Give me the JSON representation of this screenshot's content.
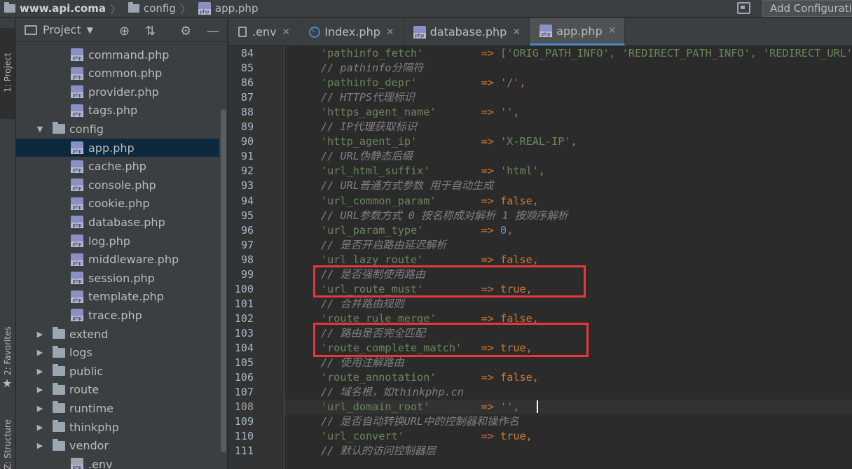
{
  "breadcrumb": {
    "root": "www.api.coma",
    "folder": "config",
    "file": "app.php"
  },
  "toolbar": {
    "add_config_label": "Add Configurati"
  },
  "left_strip": {
    "project": "1: Project",
    "favorites": "2: Favorites",
    "structure": "Z: Structure"
  },
  "project_panel": {
    "title": "Project",
    "tree": [
      {
        "label": "command.php",
        "type": "php",
        "indent": 2
      },
      {
        "label": "common.php",
        "type": "php",
        "indent": 2
      },
      {
        "label": "provider.php",
        "type": "php",
        "indent": 2
      },
      {
        "label": "tags.php",
        "type": "php",
        "indent": 2
      },
      {
        "label": "config",
        "type": "dir-open",
        "indent": 1
      },
      {
        "label": "app.php",
        "type": "php",
        "indent": 2,
        "selected": true
      },
      {
        "label": "cache.php",
        "type": "php",
        "indent": 2
      },
      {
        "label": "console.php",
        "type": "php",
        "indent": 2
      },
      {
        "label": "cookie.php",
        "type": "php",
        "indent": 2
      },
      {
        "label": "database.php",
        "type": "php",
        "indent": 2
      },
      {
        "label": "log.php",
        "type": "php",
        "indent": 2
      },
      {
        "label": "middleware.php",
        "type": "php",
        "indent": 2
      },
      {
        "label": "session.php",
        "type": "php",
        "indent": 2
      },
      {
        "label": "template.php",
        "type": "php",
        "indent": 2
      },
      {
        "label": "trace.php",
        "type": "php",
        "indent": 2
      },
      {
        "label": "extend",
        "type": "dir",
        "indent": 1
      },
      {
        "label": "logs",
        "type": "dir",
        "indent": 1
      },
      {
        "label": "public",
        "type": "dir",
        "indent": 1
      },
      {
        "label": "route",
        "type": "dir",
        "indent": 1
      },
      {
        "label": "runtime",
        "type": "dir",
        "indent": 1
      },
      {
        "label": "thinkphp",
        "type": "dir",
        "indent": 1
      },
      {
        "label": "vendor",
        "type": "dir",
        "indent": 1
      },
      {
        "label": ".env",
        "type": "file",
        "indent": 1
      }
    ]
  },
  "tabs": [
    {
      "label": ".env",
      "icon": "env-file-icon"
    },
    {
      "label": "Index.php",
      "icon": "class-icon"
    },
    {
      "label": "database.php",
      "icon": "php-file-icon"
    },
    {
      "label": "app.php",
      "icon": "php-file-icon",
      "active": true
    }
  ],
  "editor": {
    "current_line": "108",
    "lines": [
      {
        "n": "84",
        "kind": "entry",
        "key": "'pathinfo_fetch'",
        "pad": "         ",
        "val": "['ORIG_PATH_INFO', 'REDIRECT_PATH_INFO', 'REDIRECT_URL']",
        "vtype": "str"
      },
      {
        "n": "85",
        "kind": "cmt",
        "text": "// pathinfo分隔符"
      },
      {
        "n": "86",
        "kind": "entry",
        "key": "'pathinfo_depr'",
        "pad": "          ",
        "val": "'/'",
        "vtype": "str"
      },
      {
        "n": "87",
        "kind": "cmt",
        "text": "// HTTPS代理标识"
      },
      {
        "n": "88",
        "kind": "entry",
        "key": "'https_agent_name'",
        "pad": "       ",
        "val": "''",
        "vtype": "str"
      },
      {
        "n": "89",
        "kind": "cmt",
        "text": "// IP代理获取标识"
      },
      {
        "n": "90",
        "kind": "entry",
        "key": "'http_agent_ip'",
        "pad": "          ",
        "val": "'X-REAL-IP'",
        "vtype": "str"
      },
      {
        "n": "91",
        "kind": "cmt",
        "text": "// URL伪静态后缀"
      },
      {
        "n": "92",
        "kind": "entry",
        "key": "'url_html_suffix'",
        "pad": "        ",
        "val": "'html'",
        "vtype": "str"
      },
      {
        "n": "93",
        "kind": "cmt",
        "text": "// URL普通方式参数 用于自动生成"
      },
      {
        "n": "94",
        "kind": "entry",
        "key": "'url_common_param'",
        "pad": "       ",
        "val": "false",
        "vtype": "kw"
      },
      {
        "n": "95",
        "kind": "cmt",
        "text": "// URL参数方式 0 按名称成对解析 1 按顺序解析"
      },
      {
        "n": "96",
        "kind": "entry",
        "key": "'url_param_type'",
        "pad": "         ",
        "val": "0",
        "vtype": "num"
      },
      {
        "n": "97",
        "kind": "cmt",
        "text": "// 是否开启路由延迟解析"
      },
      {
        "n": "98",
        "kind": "entry",
        "key": "'url_lazy_route'",
        "pad": "         ",
        "val": "false",
        "vtype": "kw"
      },
      {
        "n": "99",
        "kind": "cmt",
        "text": "// 是否强制使用路由"
      },
      {
        "n": "100",
        "kind": "entry",
        "key": "'url_route_must'",
        "pad": "         ",
        "val": "true",
        "vtype": "kw"
      },
      {
        "n": "101",
        "kind": "cmt",
        "text": "// 合并路由规则"
      },
      {
        "n": "102",
        "kind": "entry",
        "key": "'route_rule_merge'",
        "pad": "       ",
        "val": "false",
        "vtype": "kw"
      },
      {
        "n": "103",
        "kind": "cmt",
        "text": "// 路由是否完全匹配"
      },
      {
        "n": "104",
        "kind": "entry",
        "key": "'route_complete_match'",
        "pad": "   ",
        "val": "true",
        "vtype": "kw"
      },
      {
        "n": "105",
        "kind": "cmt",
        "text": "// 使用注解路由"
      },
      {
        "n": "106",
        "kind": "entry",
        "key": "'route_annotation'",
        "pad": "       ",
        "val": "false",
        "vtype": "kw"
      },
      {
        "n": "107",
        "kind": "cmt",
        "text": "// 域名根，如thinkphp.cn"
      },
      {
        "n": "108",
        "kind": "entry",
        "key": "'url_domain_root'",
        "pad": "        ",
        "val": "''",
        "vtype": "str"
      },
      {
        "n": "109",
        "kind": "cmt",
        "text": "// 是否自动转换URL中的控制器和操作名"
      },
      {
        "n": "110",
        "kind": "entry",
        "key": "'url_convert'",
        "pad": "            ",
        "val": "true",
        "vtype": "kw"
      },
      {
        "n": "111",
        "kind": "cmt",
        "text": "// 默认的访问控制器层"
      }
    ]
  },
  "colors": {
    "highlight_box": "#e8363c",
    "selection": "#0d293e",
    "tab_underline": "#4a88c7"
  }
}
